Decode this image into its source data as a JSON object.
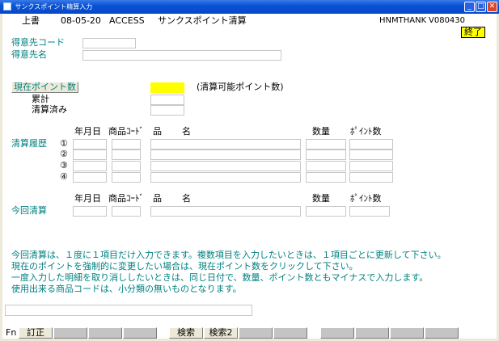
{
  "window": {
    "title": "サンクスポイント精算入力"
  },
  "header": {
    "mode": "上書",
    "date": "08-05-20",
    "db": "ACCESS",
    "screen_title": "サンクスポイント清算",
    "program_id": "HNMTHANK",
    "version": "V080430",
    "end_button": "終了"
  },
  "customer": {
    "code_label": "得意先コード",
    "code_value": "",
    "name_label": "得意先名",
    "name_value": ""
  },
  "points": {
    "current_button": "現在ポイント数",
    "current_value": "",
    "note": "(清算可能ポイント数)",
    "cumulative_label": "累計",
    "cumulative_value": "",
    "settled_label": "清算済み",
    "settled_value": ""
  },
  "history": {
    "section_label": "清算履歴",
    "columns": {
      "date": "年月日",
      "code": "商品ｺｰﾄﾞ",
      "item": "品",
      "name": "名",
      "qty": "数量",
      "points": "ﾎﾟｲﾝﾄ数"
    },
    "row_markers": [
      "①",
      "②",
      "③",
      "④"
    ]
  },
  "current": {
    "section_label": "今回清算",
    "columns": {
      "date": "年月日",
      "code": "商品ｺｰﾄﾞ",
      "item": "品",
      "name": "名",
      "qty": "数量",
      "points": "ﾎﾟｲﾝﾄ数"
    }
  },
  "messages": [
    "今回清算は、１度に１項目だけ入力できます。複数項目を入力したいときは、１項目ごとに更新して下さい。",
    "現在のポイントを強制的に変更したい場合は、現在ポイント数をクリックして下さい。",
    "一度入力した明細を取り消ししたいときは、同じ日付で、数量、ポイント数ともマイナスで入力します。",
    "使用出来る商品コードは、小分類の無いものとなります。"
  ],
  "status_field": "",
  "fnbar": {
    "label": "Fn",
    "keys": [
      "訂正",
      "",
      "",
      "",
      "",
      "検索",
      "検索2",
      "",
      "",
      "",
      "",
      "",
      ""
    ]
  },
  "colors": {
    "highlight": "#ffff00",
    "label_teal": "#008080",
    "titlebar": "#0a53d6"
  }
}
